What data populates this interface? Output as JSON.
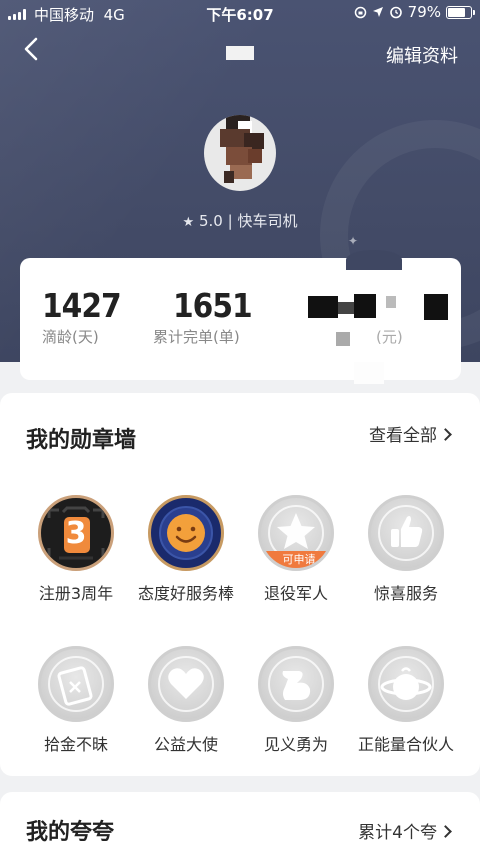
{
  "status_bar": {
    "carrier": "中国移动",
    "network": "4G",
    "time": "下午6:07",
    "battery_text": "79%",
    "battery_level": 0.79
  },
  "nav": {
    "back_icon": "chevron-left-icon",
    "edit_label": "编辑资料"
  },
  "profile": {
    "rating": "5.0",
    "separator": "|",
    "role": "快车司机"
  },
  "stats": [
    {
      "value": "1427",
      "label": "滴龄(天)"
    },
    {
      "value": "1651",
      "label": "累计完单(单)"
    },
    {
      "value": "",
      "label": "(元)"
    }
  ],
  "badges": {
    "title": "我的勋章墙",
    "view_all": "查看全部",
    "items": [
      {
        "label": "注册3周年",
        "icon": "three-year-medal-icon",
        "number": "3"
      },
      {
        "label": "态度好服务棒",
        "icon": "smile-medal-icon"
      },
      {
        "label": "退役军人",
        "icon": "star-medal-icon",
        "tag": "可申请"
      },
      {
        "label": "惊喜服务",
        "icon": "thumbs-up-medal-icon"
      },
      {
        "label": "拾金不昧",
        "icon": "wallet-medal-icon"
      },
      {
        "label": "公益大使",
        "icon": "heart-medal-icon"
      },
      {
        "label": "见义勇为",
        "icon": "muscle-medal-icon"
      },
      {
        "label": "正能量合伙人",
        "icon": "planet-medal-icon"
      }
    ]
  },
  "praise": {
    "title": "我的夸夸",
    "count_label": "累计4个夸"
  },
  "colors": {
    "header_bg": "#4a5372",
    "apply_tag": "#f07a3e",
    "medal_blue": "#2a3f8f",
    "medal_orange": "#f08a3c"
  }
}
